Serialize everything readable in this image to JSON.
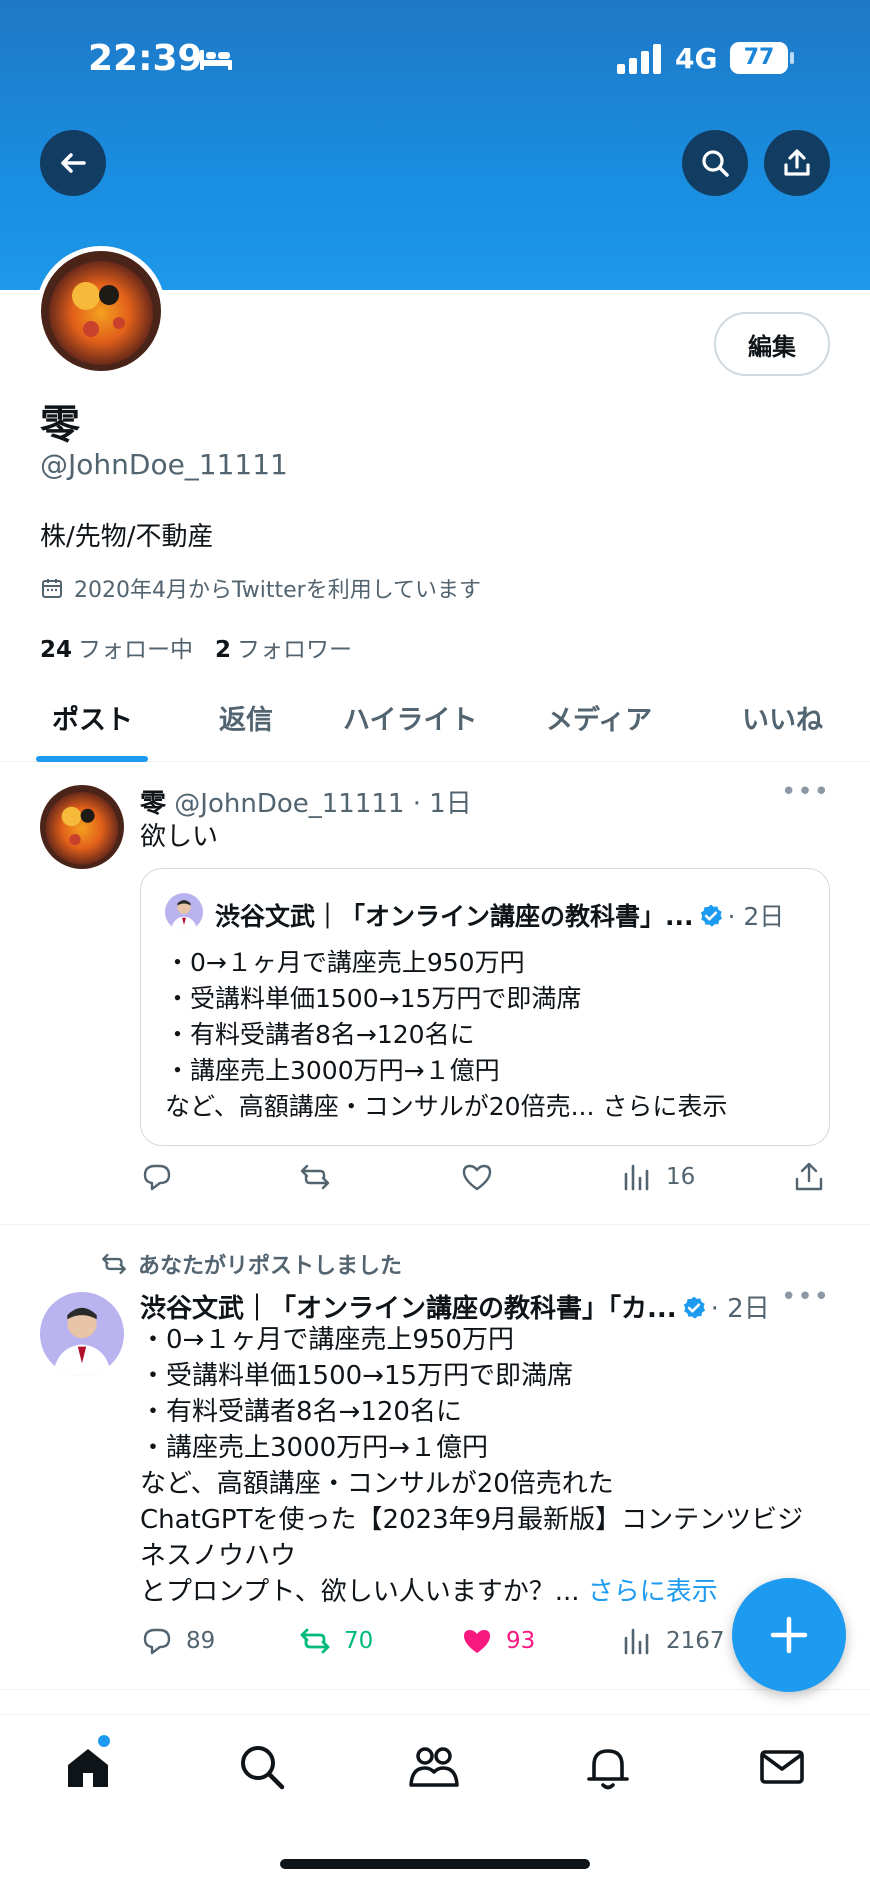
{
  "status_bar": {
    "time": "22:39",
    "network": "4G",
    "battery": "77"
  },
  "header": {
    "back_icon": "arrow-left-icon",
    "search_icon": "search-icon",
    "share_icon": "share-icon"
  },
  "profile": {
    "edit_label": "編集",
    "display_name": "零",
    "handle": "@JohnDoe_11111",
    "bio": "株/先物/不動産",
    "joined": "2020年4月からTwitterを利用しています",
    "following_count": "24",
    "following_label": "フォロー中",
    "followers_count": "2",
    "followers_label": "フォロワー"
  },
  "tabs": [
    {
      "label": "ポスト",
      "active": true
    },
    {
      "label": "返信"
    },
    {
      "label": "ハイライト"
    },
    {
      "label": "メディア"
    },
    {
      "label": "いいね"
    }
  ],
  "posts": [
    {
      "name": "零",
      "meta": "@JohnDoe_11111 · 1日",
      "text": "欲しい",
      "quote": {
        "name": "渋谷文武｜「オンライン講座の教科書」...",
        "meta": "· 2日",
        "lines": [
          "・0→１ヶ月で講座売上950万円",
          "・受講料単価1500→15万円で即満席",
          "・有料受講者8名→120名に",
          "・講座売上3000万円→１億円",
          "など、高額講座・コンサルが20倍売... さらに表示"
        ]
      },
      "actions": {
        "reply": "",
        "repost": "",
        "like": "",
        "views": "16"
      }
    },
    {
      "repost_note": "あなたがリポストしました",
      "name": "渋谷文武｜「オンライン講座の教科書」「カ...",
      "meta": "· 2日",
      "lines": [
        "・0→１ヶ月で講座売上950万円",
        "・受講料単価1500→15万円で即満席",
        "・有料受講者8名→120名に",
        "・講座売上3000万円→１億円",
        "など、高額講座・コンサルが20倍売れた",
        "ChatGPTを使った【2023年9月最新版】コンテンツビジ",
        "ネスノウハウ"
      ],
      "last_line": "とプロンプト、欲しい人いますか？... ",
      "show_more": "さらに表示",
      "actions": {
        "reply": "89",
        "repost": "70",
        "like": "93",
        "views": "2167"
      }
    }
  ],
  "colors": {
    "accent": "#1d9bf0",
    "repost_green": "#00ba7c",
    "like_pink": "#f91880",
    "banner": "#1a8de0"
  }
}
